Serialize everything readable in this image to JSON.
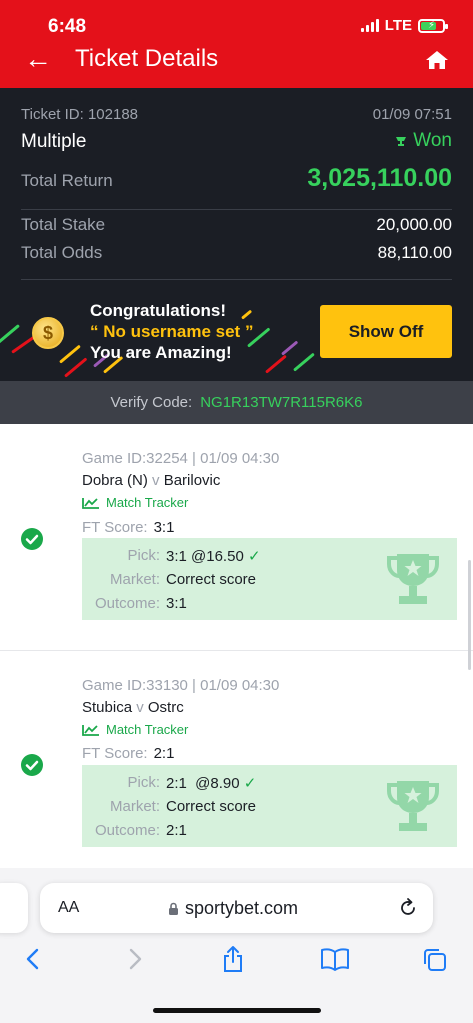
{
  "status": {
    "time": "6:48",
    "network": "LTE"
  },
  "header": {
    "title": "Ticket Details"
  },
  "ticket": {
    "id_label": "Ticket ID: 102188",
    "date": "01/09 07:51",
    "type": "Multiple",
    "result": "Won",
    "total_return_label": "Total Return",
    "total_return": "3,025,110.00",
    "total_stake_label": "Total Stake",
    "total_stake": "20,000.00",
    "total_odds_label": "Total Odds",
    "total_odds": "88,110.00"
  },
  "congrats": {
    "line1": "Congratulations!",
    "line2": "“ No username set ”",
    "line3": "You are Amazing!",
    "button": "Show Off"
  },
  "verify": {
    "label": "Verify Code:",
    "code": "NG1R13TW7R115R6K6"
  },
  "games": [
    {
      "header": "Game ID:32254 | 01/09 04:30",
      "home": "Dobra (N)",
      "vs": "v",
      "away": "Barilovic",
      "tracker": "Match Tracker",
      "ft_label": "FT Score:",
      "ft_score": "3:1",
      "pick_label": "Pick:",
      "pick": "3:1 @16.50",
      "market_label": "Market:",
      "market": "Correct score",
      "outcome_label": "Outcome:",
      "outcome": "3:1"
    },
    {
      "header": "Game ID:33130 | 01/09 04:30",
      "home": "Stubica",
      "vs": "v",
      "away": "Ostrc",
      "tracker": "Match Tracker",
      "ft_label": "FT Score:",
      "ft_score": "2:1",
      "pick_label": "Pick:",
      "pick": "2:1  @8.90",
      "market_label": "Market:",
      "market": "Correct score",
      "outcome_label": "Outcome:",
      "outcome": "2:1"
    }
  ],
  "browser": {
    "aa": "AA",
    "url": "sportybet.com"
  },
  "colors": {
    "brand_red": "#e4111a",
    "win_green": "#37d15d",
    "accent_yellow": "#ffc20e"
  }
}
